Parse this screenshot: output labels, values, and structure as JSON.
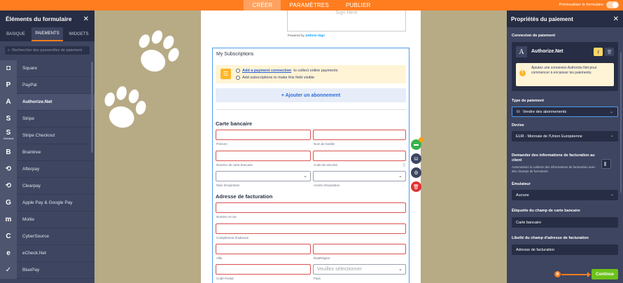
{
  "topbar": {
    "tabs": [
      {
        "label": "CRÉER",
        "active": true
      },
      {
        "label": "PARAMÈTRES",
        "active": false
      },
      {
        "label": "PUBLIER",
        "active": false
      }
    ],
    "preview_label": "Prévisualiser le formulaire"
  },
  "left_panel": {
    "title": "Éléments du formulaire",
    "tabs": [
      "BASIQUE",
      "PAIEMENTS",
      "WIDGETS"
    ],
    "search_placeholder": "Rechercher des passerelles de paiement",
    "items": [
      {
        "label": "Square",
        "icon": "square-logo-icon",
        "glyph": "◘"
      },
      {
        "label": "PayPal",
        "icon": "paypal-logo-icon",
        "glyph": "P"
      },
      {
        "label": "Authorize.Net",
        "icon": "authorize-net-logo-icon",
        "glyph": "A"
      },
      {
        "label": "Stripe",
        "icon": "stripe-logo-icon",
        "glyph": "S"
      },
      {
        "label": "Stripe Checkout",
        "icon": "stripe-checkout-logo-icon",
        "glyph": "S",
        "sub": "Checkout"
      },
      {
        "label": "Braintree",
        "icon": "braintree-logo-icon",
        "glyph": "B"
      },
      {
        "label": "Afterpay",
        "icon": "afterpay-logo-icon",
        "glyph": "⟲"
      },
      {
        "label": "Clearpay",
        "icon": "clearpay-logo-icon",
        "glyph": "⟲"
      },
      {
        "label": "Apple Pay & Google Pay",
        "icon": "apple-google-pay-logo-icon",
        "glyph": "G"
      },
      {
        "label": "Mollie",
        "icon": "mollie-logo-icon",
        "glyph": "m"
      },
      {
        "label": "CyberSource",
        "icon": "cybersource-logo-icon",
        "glyph": "C"
      },
      {
        "label": "eCheck.Net",
        "icon": "echeck-logo-icon",
        "glyph": "e"
      },
      {
        "label": "BluePay",
        "icon": "bluepay-logo-icon",
        "glyph": "✓"
      }
    ]
  },
  "form": {
    "sign_placeholder": "Sign Here",
    "powered_prefix": "Powered by",
    "powered_brand": "Jotform Sign",
    "widget_title": "My Subscriptions",
    "notice_link": "Add a payment connection",
    "notice_rest": "to collect online payments",
    "notice_line2": "Add subscriptions to make this field visible",
    "add_subscription": "+ Ajouter un abonnement",
    "card_section": "Carte bancaire",
    "labels": {
      "first_name": "Prénom",
      "last_name": "Nom de famille",
      "card_number": "Numéro de carte bancaire",
      "security_code": "Code de sécurité",
      "exp_month": "Mois d'expiration",
      "exp_year": "Année d'expiration",
      "street": "Numéro et rue",
      "street2": "Complément d'adresse",
      "city": "Ville",
      "state": "État/Région",
      "zip": "Code Postal",
      "country": "Pays"
    },
    "billing_section": "Adresse de facturation",
    "country_placeholder": "Veuillez sélectionner"
  },
  "right_panel": {
    "title": "Propriétés du paiement",
    "connection_label": "Connexion de paiement",
    "connection_name": "Authorize.Net",
    "connection_warning": "Ajoutez une connexion Authorize.Net pour commencer à encaisser les paiements.",
    "payment_type_label": "Type de paiement",
    "payment_type_value": "Vendre des abonnements",
    "currency_label": "Devise",
    "currency_value": "EUR - Monnaie de l'Union Européenne",
    "billing_info_label": "Demander des informations de facturation au client",
    "billing_info_desc": "Automatisez la collecte des informations de facturation avec des champs de formulaire.",
    "emulator_label": "Émulateur",
    "emulator_value": "Aucune",
    "card_field_label": "Étiquette du champ de carte bancaire",
    "card_field_value": "Carte bancaire",
    "billing_field_label": "Libellé du champ d'adresse de facturation",
    "billing_field_value": "Adresse de facturation",
    "continue_label": "Continue",
    "step_number": "6"
  },
  "colors": {
    "accent": "#ff7d1f",
    "panel": "#3d4560",
    "panel_dark": "#272d44",
    "canvas": "#b7ab86",
    "continue": "#6cc11c",
    "error_border": "#d9534f"
  }
}
